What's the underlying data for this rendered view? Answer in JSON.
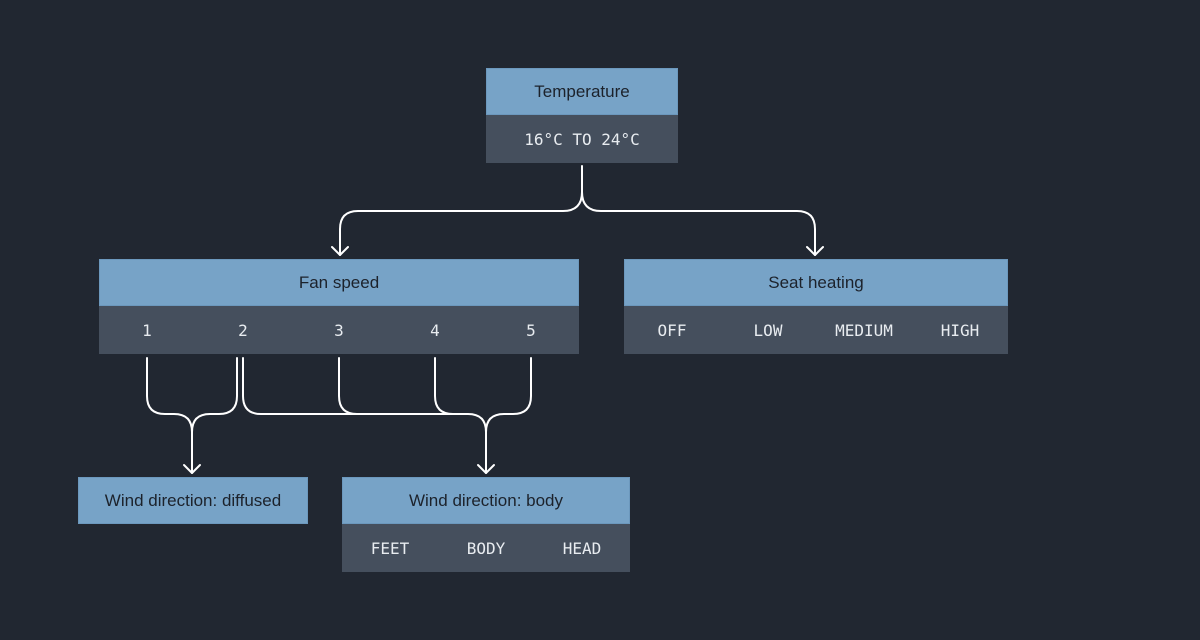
{
  "nodes": {
    "temperature": {
      "title": "Temperature",
      "options": [
        "16°C TO 24°C"
      ]
    },
    "fan_speed": {
      "title": "Fan speed",
      "options": [
        "1",
        "2",
        "3",
        "4",
        "5"
      ]
    },
    "seat_heating": {
      "title": "Seat heating",
      "options": [
        "OFF",
        "LOW",
        "MEDIUM",
        "HIGH"
      ]
    },
    "wind_diffused": {
      "title": "Wind direction: diffused"
    },
    "wind_body": {
      "title": "Wind direction: body",
      "options": [
        "FEET",
        "BODY",
        "HEAD"
      ]
    }
  },
  "edges": [
    {
      "from": "temperature",
      "to": "fan_speed"
    },
    {
      "from": "temperature",
      "to": "seat_heating"
    },
    {
      "from": "fan_speed.1",
      "to": "wind_diffused"
    },
    {
      "from": "fan_speed.2",
      "to": "wind_diffused"
    },
    {
      "from": "fan_speed.2",
      "to": "wind_body"
    },
    {
      "from": "fan_speed.3",
      "to": "wind_body"
    },
    {
      "from": "fan_speed.4",
      "to": "wind_body"
    },
    {
      "from": "fan_speed.5",
      "to": "wind_body"
    }
  ],
  "colors": {
    "background": "#212731",
    "header": "#77a3c7",
    "row": "#454f5d",
    "line": "#ffffff"
  }
}
